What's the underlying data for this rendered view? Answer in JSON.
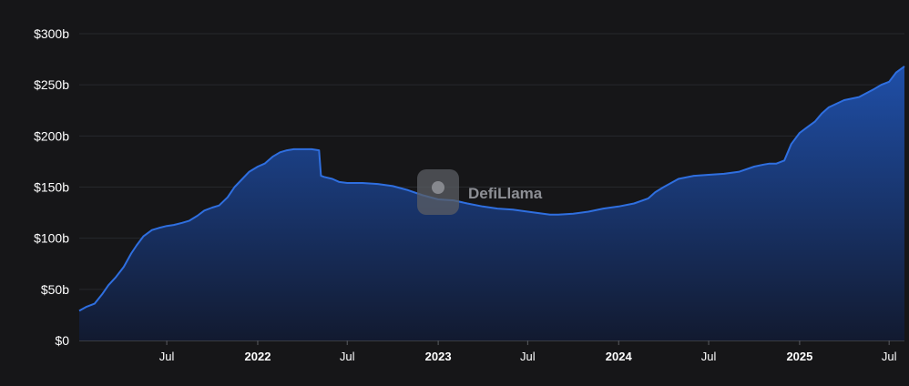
{
  "chart_data": {
    "type": "area",
    "title": "",
    "xlabel": "",
    "ylabel": "",
    "ylim": [
      0,
      300
    ],
    "y_ticks": [
      "$0",
      "$50b",
      "$100b",
      "$150b",
      "$200b",
      "$250b",
      "$300b"
    ],
    "y_tick_values": [
      0,
      50,
      100,
      150,
      200,
      250,
      300
    ],
    "x_ticks": [
      {
        "label": "Jul",
        "date": "2021-07-01",
        "bold": false
      },
      {
        "label": "2022",
        "date": "2022-01-01",
        "bold": true
      },
      {
        "label": "Jul",
        "date": "2022-07-01",
        "bold": false
      },
      {
        "label": "2023",
        "date": "2023-01-01",
        "bold": true
      },
      {
        "label": "Jul",
        "date": "2023-07-01",
        "bold": false
      },
      {
        "label": "2024",
        "date": "2024-01-01",
        "bold": true
      },
      {
        "label": "Jul",
        "date": "2024-07-01",
        "bold": false
      },
      {
        "label": "2025",
        "date": "2025-01-01",
        "bold": true
      },
      {
        "label": "Jul",
        "date": "2025-07-01",
        "bold": false
      }
    ],
    "x_range": [
      "2021-01-05",
      "2025-08-01"
    ],
    "grid": true,
    "colors": {
      "line": "#2f6fe0",
      "fill_top": "#1f4fa8",
      "fill_bottom": "#121a30",
      "background": "#161618",
      "grid": "#26282c"
    },
    "series": [
      {
        "x": [
          "2021-01-05",
          "2021-01-20",
          "2021-02-05",
          "2021-02-20",
          "2021-03-05",
          "2021-03-20",
          "2021-04-05",
          "2021-04-20",
          "2021-05-01",
          "2021-05-15",
          "2021-06-01",
          "2021-06-15",
          "2021-07-01",
          "2021-07-15",
          "2021-08-01",
          "2021-08-15",
          "2021-09-01",
          "2021-09-15",
          "2021-10-01",
          "2021-10-15",
          "2021-11-01",
          "2021-11-15",
          "2021-12-01",
          "2021-12-15",
          "2022-01-01",
          "2022-01-15",
          "2022-02-01",
          "2022-02-15",
          "2022-03-01",
          "2022-03-15",
          "2022-04-01",
          "2022-04-20",
          "2022-05-05",
          "2022-05-09",
          "2022-05-15",
          "2022-06-01",
          "2022-06-15",
          "2022-07-01",
          "2022-08-01",
          "2022-09-01",
          "2022-10-01",
          "2022-11-01",
          "2022-12-01",
          "2023-01-01",
          "2023-02-01",
          "2023-03-01",
          "2023-04-01",
          "2023-05-01",
          "2023-06-01",
          "2023-07-01",
          "2023-08-01",
          "2023-08-15",
          "2023-09-01",
          "2023-10-01",
          "2023-11-01",
          "2023-12-01",
          "2024-01-01",
          "2024-02-01",
          "2024-03-01",
          "2024-03-15",
          "2024-04-01",
          "2024-05-01",
          "2024-06-01",
          "2024-07-01",
          "2024-08-01",
          "2024-09-01",
          "2024-10-01",
          "2024-10-20",
          "2024-11-01",
          "2024-11-15",
          "2024-12-01",
          "2024-12-15",
          "2025-01-01",
          "2025-01-15",
          "2025-02-01",
          "2025-02-15",
          "2025-03-01",
          "2025-04-01",
          "2025-05-01",
          "2025-06-01",
          "2025-06-15",
          "2025-07-01",
          "2025-07-15",
          "2025-08-01"
        ],
        "values": [
          29,
          33,
          36,
          45,
          54,
          62,
          72,
          85,
          93,
          102,
          108,
          110,
          112,
          113,
          115,
          117,
          122,
          127,
          130,
          132,
          140,
          150,
          158,
          165,
          170,
          173,
          180,
          184,
          186,
          187,
          187,
          187,
          186,
          161,
          160,
          158,
          155,
          154,
          154,
          153,
          151,
          147,
          142,
          138,
          137,
          134,
          131,
          129,
          128,
          126,
          124,
          123,
          123,
          124,
          126,
          129,
          131,
          134,
          139,
          145,
          150,
          158,
          161,
          162,
          163,
          165,
          170,
          172,
          173,
          173,
          176,
          192,
          203,
          208,
          214,
          222,
          228,
          235,
          238,
          246,
          250,
          253,
          262,
          268
        ]
      }
    ],
    "watermark": "DefiLlama"
  }
}
